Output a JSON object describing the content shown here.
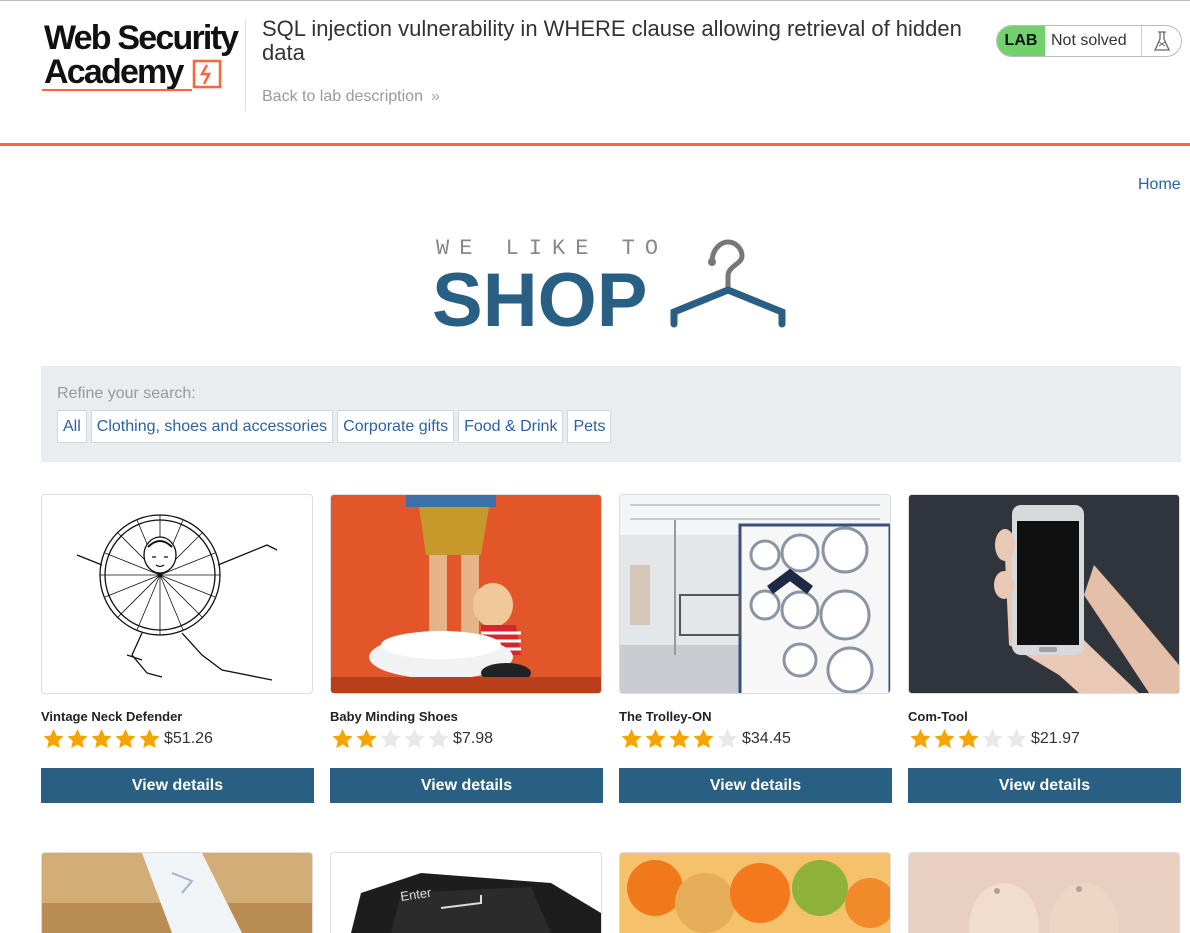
{
  "header": {
    "logo_line1": "Web Security",
    "logo_line2": "Academy",
    "lab_title": "SQL injection vulnerability in WHERE clause allowing retrieval of hidden data",
    "back_link": "Back to lab description",
    "lab_tag": "LAB",
    "lab_status": "Not solved"
  },
  "nav": {
    "home": "Home"
  },
  "shop_logo": {
    "tagline": "WE LIKE TO",
    "word": "SHOP"
  },
  "search": {
    "label": "Refine your search:",
    "filters": [
      "All",
      "Clothing, shoes and accessories",
      "Corporate gifts",
      "Food & Drink",
      "Pets"
    ]
  },
  "products": [
    {
      "name": "Vintage Neck Defender",
      "rating": 5,
      "price": "$51.26",
      "button": "View details",
      "image": "sketch of man in ruffled collar"
    },
    {
      "name": "Baby Minding Shoes",
      "rating": 2,
      "price": "$7.98",
      "button": "View details",
      "image": "figurine with big shoes on orange"
    },
    {
      "name": "The Trolley-ON",
      "rating": 4,
      "price": "$34.45",
      "button": "View details",
      "image": "laundromat with washing machines"
    },
    {
      "name": "Com-Tool",
      "rating": 3,
      "price": "$21.97",
      "button": "View details",
      "image": "hand holding smartphone"
    }
  ],
  "products_row2": [
    {
      "image": "paper plane"
    },
    {
      "image": "enter key cushion"
    },
    {
      "image": "oranges and fruit"
    },
    {
      "image": "eggs"
    }
  ],
  "colors": {
    "accent": "#ff6633",
    "link": "#2863a2",
    "button": "#285f82",
    "star": "#f5a500",
    "lab_green": "#70d16d"
  }
}
